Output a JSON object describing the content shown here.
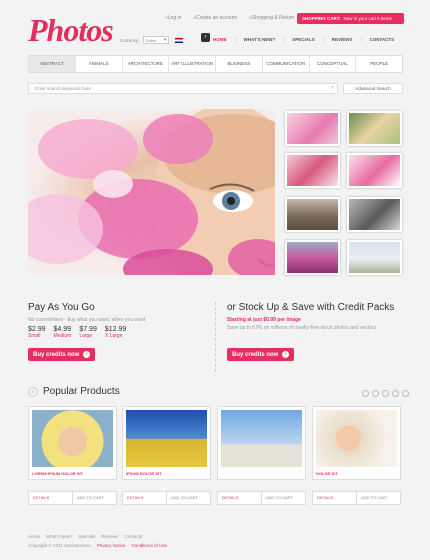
{
  "brand": {
    "logo": "Photos",
    "accent": "#e42e5f"
  },
  "top_links": [
    "Log in",
    "Create an account",
    "Shopping & Return"
  ],
  "cart": {
    "label": "SHOPPING CART:",
    "status": "Now in your cart 0 items"
  },
  "currency": {
    "label": "Currency:",
    "value": "Dollar"
  },
  "main_nav": [
    "HOME",
    "WHAT'S NEW?",
    "SPECIALS",
    "REVIEWS",
    "CONTACTS"
  ],
  "categories": [
    "Abstract",
    "Animals",
    "Architecture",
    "Art Illustration",
    "Business",
    "Communication",
    "Conceptual",
    "People"
  ],
  "search": {
    "placeholder": "Enter search keywords here",
    "advanced": "Advanced Search"
  },
  "pay": {
    "title": "Pay As You Go",
    "subtitle": "No commitment - buy what you want, when you want",
    "prices": [
      {
        "amount": "$2.99",
        "size": "Small"
      },
      {
        "amount": "$4.99",
        "size": "Medium"
      },
      {
        "amount": "$7.99",
        "size": "Large"
      },
      {
        "amount": "$12.99",
        "size": "X Large"
      }
    ],
    "button": "Buy credits now"
  },
  "stock": {
    "title": "or Stock Up & Save with Credit Packs",
    "highlight": "Starting at just $0.99 per image",
    "subtitle": "Save up to 67% on millions of royalty-free stock photos and vectors",
    "button": "Buy credits now"
  },
  "popular": {
    "title": "Popular Products",
    "products": [
      {
        "name": "LOREM IPSUM DOLOR SIT",
        "price": ""
      },
      {
        "name": "IPSUM DOLOR SIT",
        "price": ""
      },
      {
        "name": "",
        "price": ""
      },
      {
        "name": "DOLOR SIT",
        "price": ""
      }
    ],
    "details_label": "DETAILS",
    "cart_label": "ADD TO CART"
  },
  "footer": {
    "links": [
      "Home",
      "What's New?",
      "Specials",
      "Reviews",
      "Contacts"
    ],
    "copyright": "Copyright © 2011 osCommerce",
    "privacy": "Privacy Notice",
    "conditions": "Conditions of Use"
  }
}
